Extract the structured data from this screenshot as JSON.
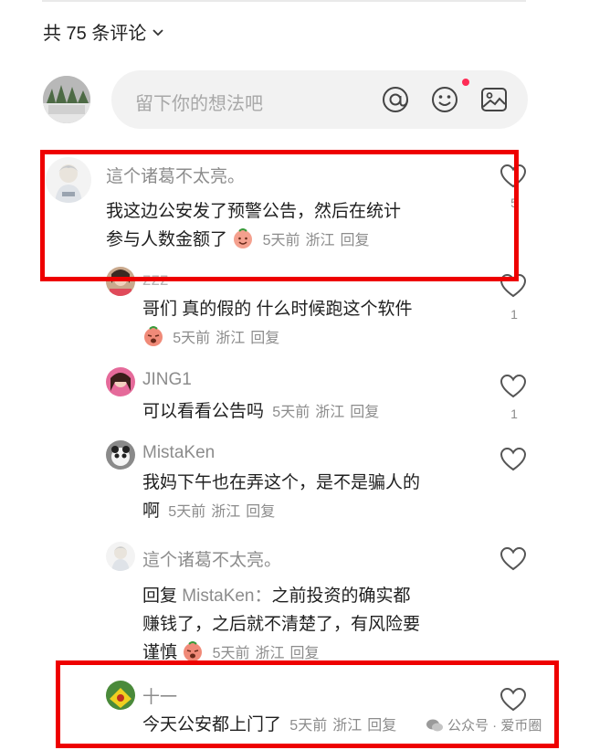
{
  "header": {
    "comment_count_label": "共 75 条评论"
  },
  "composer": {
    "placeholder": "留下你的想法吧"
  },
  "comments": [
    {
      "user": "這个诸葛不太亮。",
      "text_line1": "我这边公安发了预警公告，然后在统计",
      "text_line2": "参与人数金额了",
      "time": "5天前",
      "location": "浙江",
      "reply": "回复",
      "likes": "5"
    },
    {
      "user": "zzz",
      "text_line1": "哥们 真的假的 什么时候跑这个软件",
      "time": "5天前",
      "location": "浙江",
      "reply": "回复",
      "likes": "1"
    },
    {
      "user": "JING1",
      "text_line1": "可以看看公告吗",
      "time": "5天前",
      "location": "浙江",
      "reply": "回复",
      "likes": "1"
    },
    {
      "user": "MistaKen",
      "text_line1": "我妈下午也在弄这个，是不是骗人的",
      "text_line2": "啊",
      "time": "5天前",
      "location": "浙江",
      "reply": "回复",
      "likes": ""
    },
    {
      "user": "這个诸葛不太亮。",
      "reply_prefix": "回复",
      "reply_to": "MistaKen：",
      "text_line1": "之前投资的确实都",
      "text_line2": "赚钱了，之后就不清楚了，有风险要",
      "text_line3": "谨慎",
      "time": "5天前",
      "location": "浙江",
      "reply": "回复",
      "likes": ""
    },
    {
      "user": "十一",
      "text_line1": "今天公安都上门了",
      "time": "5天前",
      "location": "浙江",
      "reply": "回复",
      "likes": ""
    }
  ],
  "watermark": {
    "text": "公众号 · 爱币圈"
  },
  "colors": {
    "highlight_box": "#ee0000",
    "notification_dot": "#fe2c55"
  }
}
